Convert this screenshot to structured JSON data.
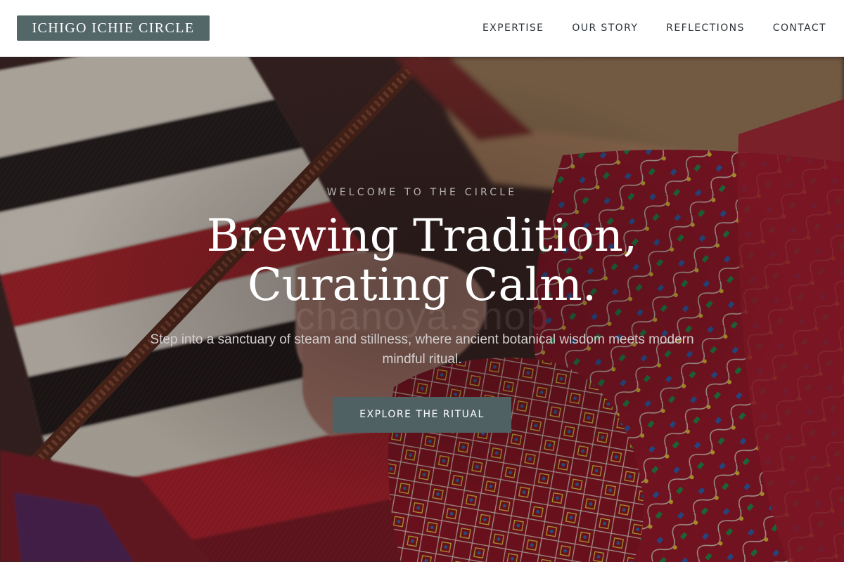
{
  "header": {
    "logo_text": "ICHIGO ICHIE CIRCLE",
    "nav": [
      {
        "label": "EXPERTISE"
      },
      {
        "label": "OUR STORY"
      },
      {
        "label": "REFLECTIONS"
      },
      {
        "label": "CONTACT"
      }
    ]
  },
  "hero": {
    "eyebrow": "WELCOME TO THE CIRCLE",
    "headline_line1": "Brewing Tradition,",
    "headline_line2": "Curating Calm.",
    "subtitle": "Step into a sanctuary of steam and stillness, where ancient botanical wisdom meets modern mindful ritual.",
    "cta_label": "EXPLORE THE RITUAL",
    "watermark": "chanoya.shop"
  },
  "colors": {
    "header_bg": "#ffffff",
    "brand": "#536668",
    "cta_bg": "#4f6163",
    "nav_text": "#2c3338",
    "headline": "#ffffff",
    "subtitle": "#d3d0cf",
    "eyebrow": "#b7b4b2"
  }
}
